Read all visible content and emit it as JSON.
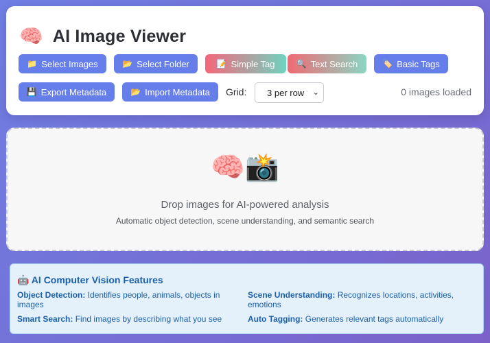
{
  "app": {
    "title": "AI Image Viewer",
    "logo_glyph": "🧠",
    "logo_icon": "brain-icon"
  },
  "toolbar": {
    "select_images": {
      "icon": "📁",
      "label": "Select Images"
    },
    "select_folder": {
      "icon": "📂",
      "label": "Select Folder"
    },
    "simple_tag": {
      "icon": "📝",
      "label": "Simple Tag"
    },
    "text_search": {
      "icon": "🔍",
      "label": "Text Search"
    },
    "basic_tags": {
      "icon": "🏷️",
      "label": "Basic Tags"
    },
    "export_metadata": {
      "icon": "💾",
      "label": "Export Metadata"
    },
    "import_metadata": {
      "icon": "📂",
      "label": "Import Metadata"
    },
    "grid_label": "Grid:",
    "grid_selected": "3 per row",
    "image_count": "0 images loaded"
  },
  "drop_zone": {
    "icons": "🧠📸",
    "title": "Drop images for AI-powered analysis",
    "subtitle": "Automatic object detection, scene understanding, and semantic search"
  },
  "features": {
    "heading": "🤖 AI Computer Vision Features",
    "items": [
      {
        "name": "Object Detection:",
        "desc": "Identifies people, animals, objects in images"
      },
      {
        "name": "Scene Understanding:",
        "desc": "Recognizes locations, activities, emotions"
      },
      {
        "name": "Smart Search:",
        "desc": "Find images by describing what you see"
      },
      {
        "name": "Auto Tagging:",
        "desc": "Generates relevant tags automatically"
      }
    ]
  },
  "colors": {
    "accent": "#667eea",
    "features_text": "#1b5fa8",
    "features_bg": "#e4f1fb"
  }
}
